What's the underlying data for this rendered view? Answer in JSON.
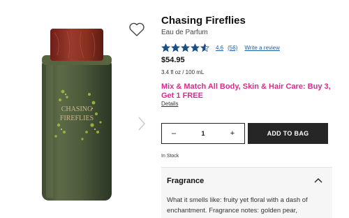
{
  "product": {
    "title": "Chasing Fireflies",
    "subtitle": "Eau de Parfum",
    "rating_value": "4.6",
    "rating_count": "(56)",
    "rating_stars": 4.6,
    "write_review_label": "Write a review",
    "price": "$54.95",
    "size": "3.4 fl oz / 100 mL",
    "bottle_label_line1": "CHASING",
    "bottle_label_line2": "FIREFLIES"
  },
  "promo": {
    "text": "Mix & Match All Body, Skin & Hair Care: Buy 3, Get 1 FREE",
    "details_label": "Details"
  },
  "cart": {
    "minus_label": "–",
    "quantity": "1",
    "plus_label": "+",
    "add_label": "ADD TO BAG",
    "stock_status": "In Stock"
  },
  "fragrance": {
    "heading": "Fragrance",
    "description": "What it smells like: fruity yet floral with a dash of enchantment. Fragrance notes: golden pear,"
  },
  "icons": {
    "wishlist": "heart-outline-icon",
    "next": "chevron-right-icon",
    "collapse": "chevron-up-icon",
    "star": "star-icon"
  },
  "colors": {
    "star": "#1b4f84",
    "link": "#1b5fa8",
    "promo": "#d42d8f",
    "button": "#262626",
    "bottle_glass": "#4a5a3c",
    "cap": "#8e2a22"
  }
}
